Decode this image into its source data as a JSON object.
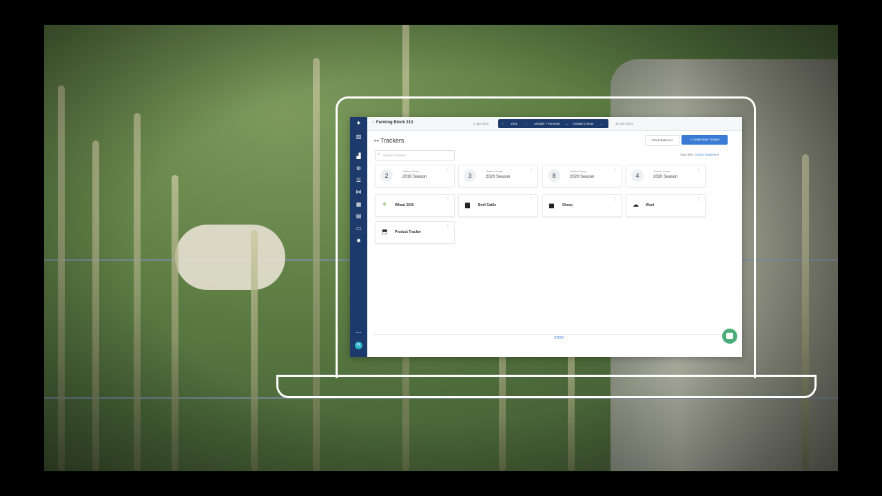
{
  "colors": {
    "sidebar": "#1c3a6b",
    "primary": "#3a7bd5",
    "chat": "#4caf7a"
  },
  "sidebar": {
    "icons": [
      "logo-icon",
      "farm-icon",
      "chart-icon",
      "tracker-icon",
      "list-icon",
      "network-icon",
      "table-icon",
      "document-icon",
      "book-icon",
      "gear-icon",
      "more-icon"
    ],
    "avatar": "PL"
  },
  "topbar": {
    "farm_name": "Farming Block 213",
    "date_start": "1 Jan 2021",
    "date_end": "31 Dec 2021",
    "year": "2021",
    "mode": "Actuals + Forecast",
    "actuals": "Actuals to Now"
  },
  "page": {
    "title": "Trackers",
    "stock_button": "Stock Balancer",
    "create_button": "+ Create New Tracker",
    "search_placeholder": "Search Trackers",
    "view_filter_label": "View filter:",
    "view_filter_value": "Active Trackers"
  },
  "groups": [
    {
      "count": "2",
      "label": "Tracker Group",
      "name": "2019 Season"
    },
    {
      "count": "3",
      "label": "Tracker Group",
      "name": "2020 Season"
    },
    {
      "count": "8",
      "label": "Tracker Group",
      "name": "2020 Season"
    },
    {
      "count": "4",
      "label": "Tracker Group",
      "name": "2020 Season"
    }
  ],
  "trackers": [
    {
      "icon": "wheat-icon",
      "name": "Wheat 2020"
    },
    {
      "icon": "cattle-icon",
      "name": "Beef Cattle"
    },
    {
      "icon": "sheep-icon",
      "name": "Sheep"
    },
    {
      "icon": "wool-icon",
      "name": "Wool"
    },
    {
      "icon": "box-icon",
      "name": "Product Tracker"
    }
  ],
  "footer": {
    "version": "3767K"
  }
}
